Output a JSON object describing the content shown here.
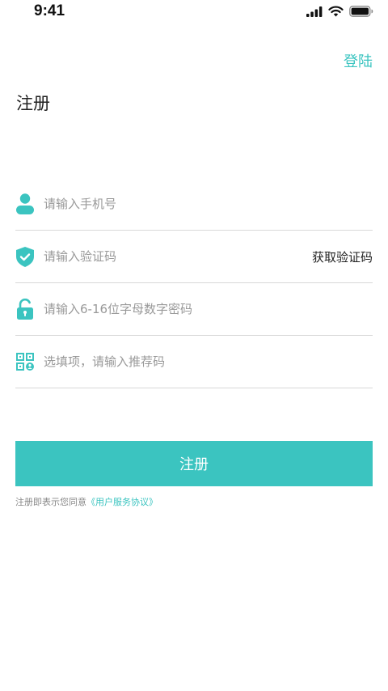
{
  "status": {
    "time": "9:41"
  },
  "header": {
    "login_link": "登陆",
    "title": "注册"
  },
  "form": {
    "phone_placeholder": "请输入手机号",
    "code_placeholder": "请输入验证码",
    "get_code_label": "获取验证码",
    "password_placeholder": "请输入6-16位字母数字密码",
    "referral_placeholder": "选填项，请输入推荐码"
  },
  "submit_label": "注册",
  "agreement": {
    "prefix": "注册即表示您同意",
    "link": "《用户服务协议》"
  },
  "colors": {
    "accent": "#3bc4c0"
  }
}
